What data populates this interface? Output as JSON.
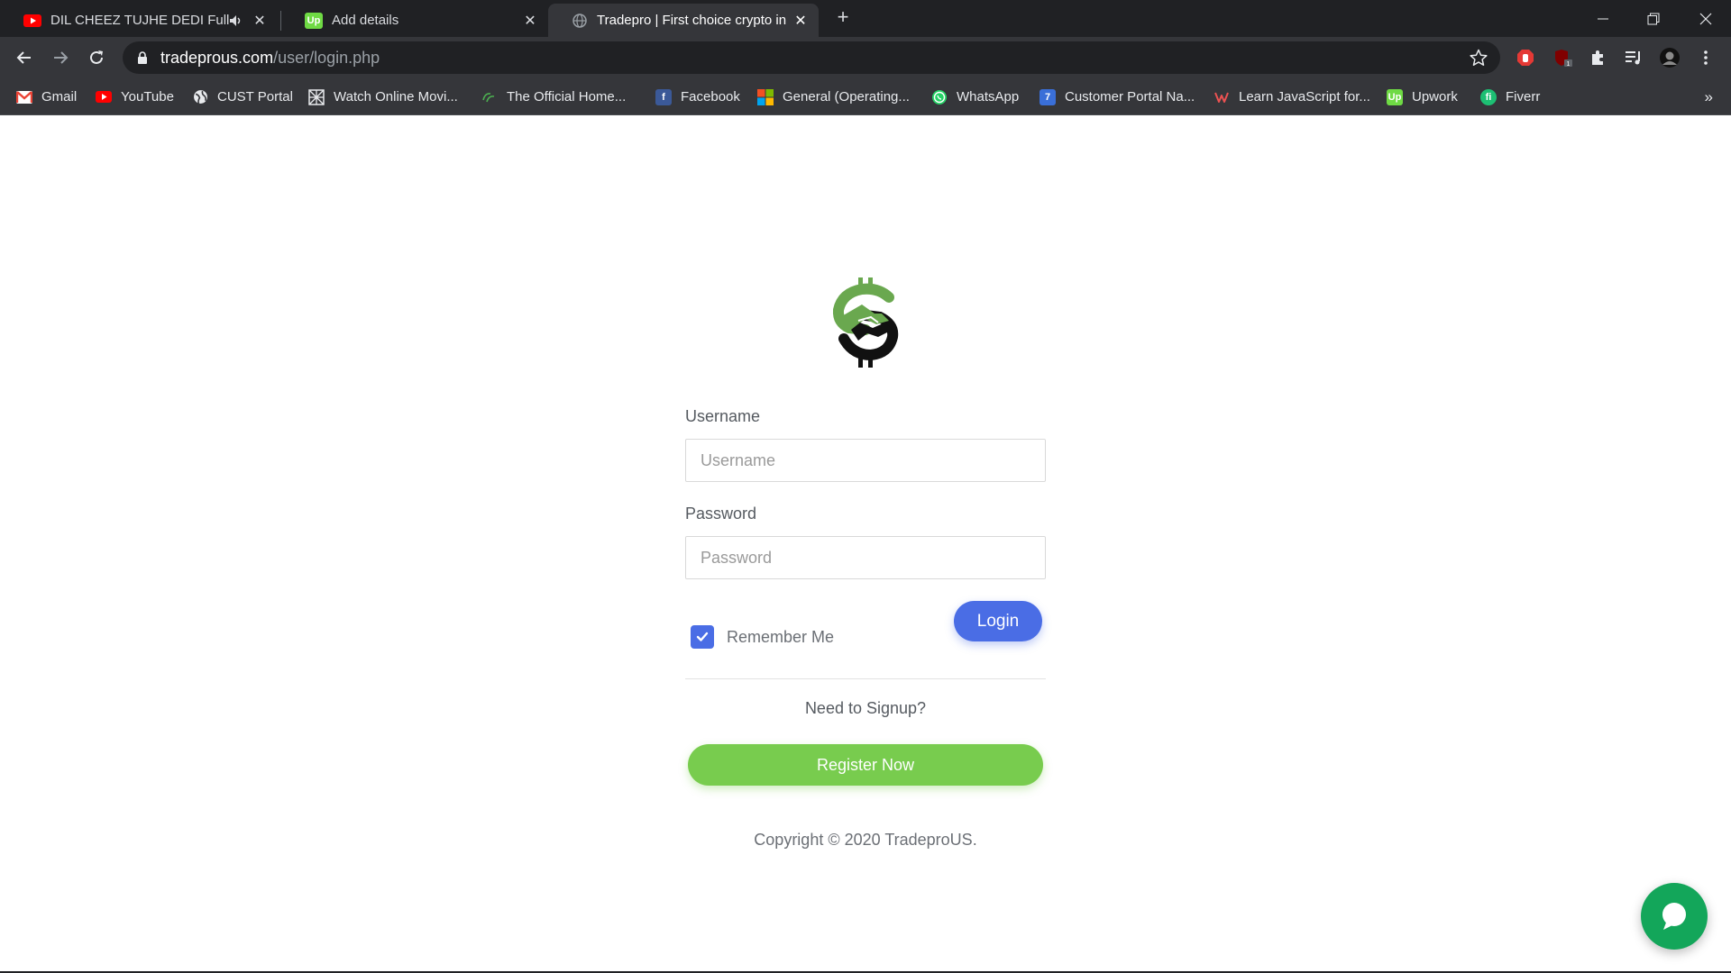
{
  "browser": {
    "tabs": [
      {
        "title": "DIL CHEEZ TUJHE DEDI Full V",
        "icon": "youtube-icon",
        "muted_icon": "speaker-icon",
        "active": false
      },
      {
        "title": "Add details",
        "icon": "upwork-icon",
        "active": false
      },
      {
        "title": "Tradepro | First choice crypto inv",
        "icon": "globe-icon",
        "active": true
      }
    ],
    "url": {
      "host": "tradeprous.com",
      "path": "/user/login.php"
    },
    "bookmarks": [
      {
        "label": "Gmail",
        "icon": "gmail-icon",
        "color": "#ea4335"
      },
      {
        "label": "YouTube",
        "icon": "youtube-icon",
        "color": "#ff0000"
      },
      {
        "label": "CUST Portal",
        "icon": "globe-icon",
        "color": "#e8eaed"
      },
      {
        "label": "Watch Online Movi...",
        "icon": "grid-icon",
        "color": "#e8eaed"
      },
      {
        "label": "The Official Home...",
        "icon": "leaf-icon",
        "color": "#4caf50"
      },
      {
        "label": "Facebook",
        "icon": "facebook-icon",
        "color": "#3b5998"
      },
      {
        "label": "General (Operating...",
        "icon": "microsoft-icon",
        "color": "#f25022"
      },
      {
        "label": "WhatsApp",
        "icon": "whatsapp-icon",
        "color": "#25d366"
      },
      {
        "label": "Customer Portal Na...",
        "icon": "portal-icon",
        "color": "#3a6fd8"
      },
      {
        "label": "Learn JavaScript for...",
        "icon": "udemy-icon",
        "color": "#ec5252"
      },
      {
        "label": "Upwork",
        "icon": "upwork-icon",
        "color": "#6fda44"
      },
      {
        "label": "Fiverr",
        "icon": "fiverr-icon",
        "color": "#1dbf73"
      }
    ],
    "more_bookmarks": "»"
  },
  "login": {
    "username_label": "Username",
    "username_placeholder": "Username",
    "password_label": "Password",
    "password_placeholder": "Password",
    "remember_label": "Remember Me",
    "remember_checked": true,
    "login_button": "Login",
    "signup_question": "Need to Signup?",
    "register_button": "Register Now",
    "copyright": "Copyright © 2020 TradeproUS."
  },
  "colors": {
    "primary": "#4a6de5",
    "register": "#78cc4e",
    "chat": "#13a65a",
    "logo_green": "#6aa84f"
  }
}
